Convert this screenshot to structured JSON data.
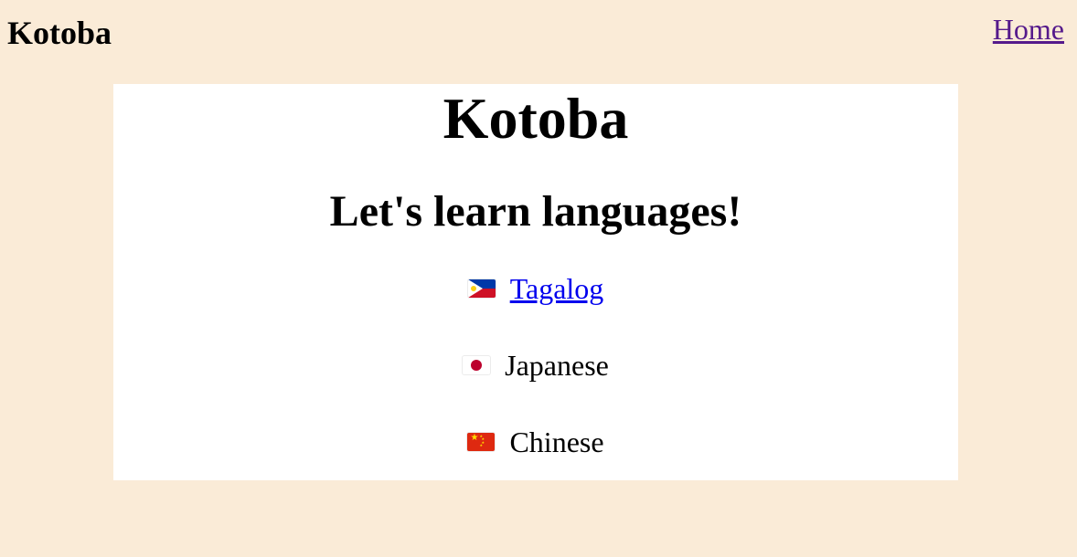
{
  "header": {
    "brand": "Kotoba",
    "home_link": "Home"
  },
  "main": {
    "title": "Kotoba",
    "subtitle": "Let's learn languages!",
    "languages": [
      {
        "flag": "philippines-flag-icon",
        "label": "Tagalog",
        "is_link": true
      },
      {
        "flag": "japan-flag-icon",
        "label": "Japanese",
        "is_link": false
      },
      {
        "flag": "china-flag-icon",
        "label": "Chinese",
        "is_link": false
      }
    ]
  },
  "colors": {
    "page_background": "#faebd7",
    "card_background": "#ffffff",
    "link_unvisited": "#0000ee",
    "link_visited": "#551a8b"
  }
}
